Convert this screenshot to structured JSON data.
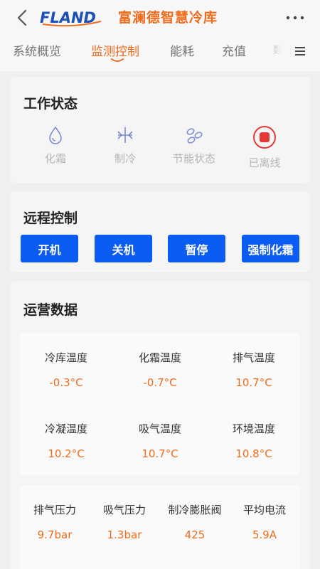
{
  "header": {
    "logo_text": "FLAND",
    "title": "富澜德智慧冷库"
  },
  "tabs": [
    {
      "label": "系统概览",
      "active": false
    },
    {
      "label": "监测控制",
      "active": true
    },
    {
      "label": "能耗",
      "active": false
    },
    {
      "label": "充值",
      "active": false
    },
    {
      "label": "数",
      "active": false
    }
  ],
  "work_status": {
    "title": "工作状态",
    "items": [
      {
        "label": "化霜",
        "icon": "droplet-icon"
      },
      {
        "label": "制冷",
        "icon": "snowflake-icon"
      },
      {
        "label": "节能状态",
        "icon": "leaf-icon"
      },
      {
        "label": "已离线",
        "icon": "offline-stop-icon"
      }
    ]
  },
  "remote_control": {
    "title": "远程控制",
    "buttons": [
      "开机",
      "关机",
      "暂停",
      "强制化霜"
    ]
  },
  "operation_data": {
    "title": "运营数据",
    "temperatures": [
      {
        "label": "冷库温度",
        "value": "-0.3°C"
      },
      {
        "label": "化霜温度",
        "value": "-0.7°C"
      },
      {
        "label": "排气温度",
        "value": "10.7°C"
      },
      {
        "label": "冷凝温度",
        "value": "10.2°C"
      },
      {
        "label": "吸气温度",
        "value": "10.7°C"
      },
      {
        "label": "环境温度",
        "value": "10.8°C"
      }
    ],
    "others": [
      {
        "label": "排气压力",
        "value": "9.7bar"
      },
      {
        "label": "吸气压力",
        "value": "1.3bar"
      },
      {
        "label": "制冷膨胀阀",
        "value": "425"
      },
      {
        "label": "平均电流",
        "value": "5.9A"
      }
    ]
  },
  "colors": {
    "accent": "#ef6c1e",
    "button": "#0a5cf2",
    "offline": "#e53935",
    "icon_muted": "#7b8bd6"
  }
}
